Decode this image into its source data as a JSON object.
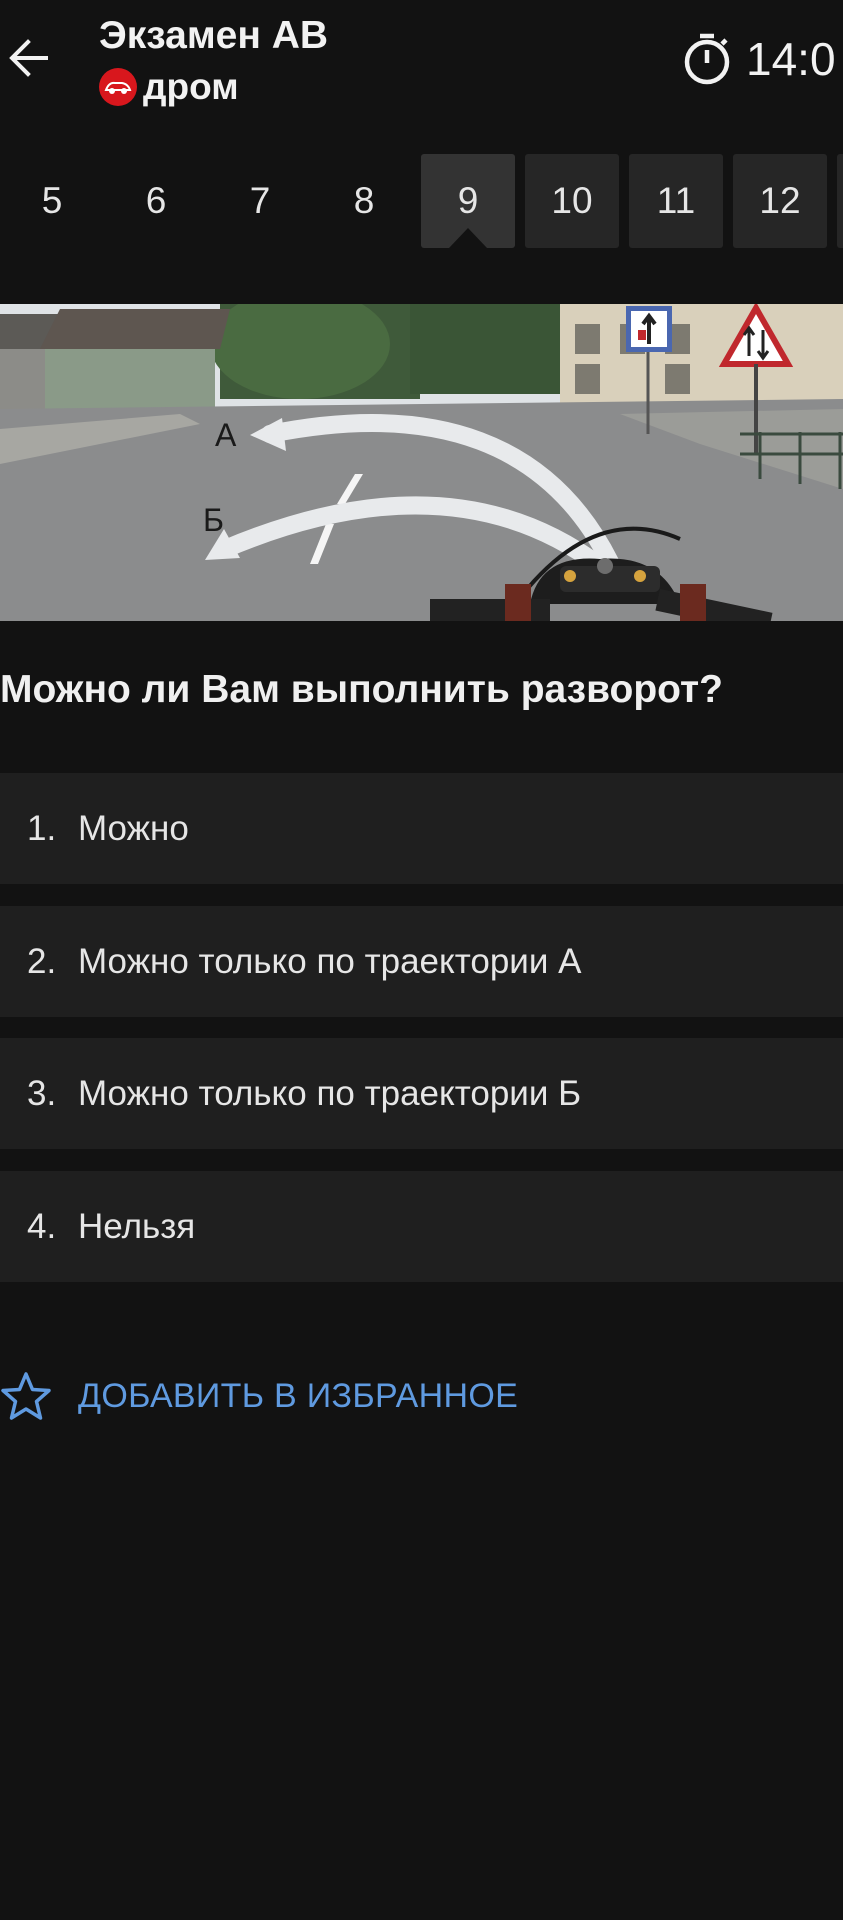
{
  "header": {
    "title": "Экзамен АВ",
    "brand": "дром",
    "timer": "14:0"
  },
  "tabs": [
    "5",
    "6",
    "7",
    "8",
    "9",
    "10",
    "11",
    "12"
  ],
  "active_tab": "9",
  "image": {
    "label_a": "А",
    "label_b": "Б"
  },
  "question": "Можно ли Вам выполнить разворот?",
  "answers": [
    {
      "num": "1.",
      "text": "Можно"
    },
    {
      "num": "2.",
      "text": "Можно только по траектории А"
    },
    {
      "num": "3.",
      "text": "Можно только по траектории Б"
    },
    {
      "num": "4.",
      "text": "Нельзя"
    }
  ],
  "favorite_label": "ДОБАВИТЬ В ИЗБРАННОЕ",
  "colors": {
    "background": "#121212",
    "answer_bg": "#1f1f1f",
    "accent": "#5f9ae0",
    "brand_red": "#d8171d"
  }
}
